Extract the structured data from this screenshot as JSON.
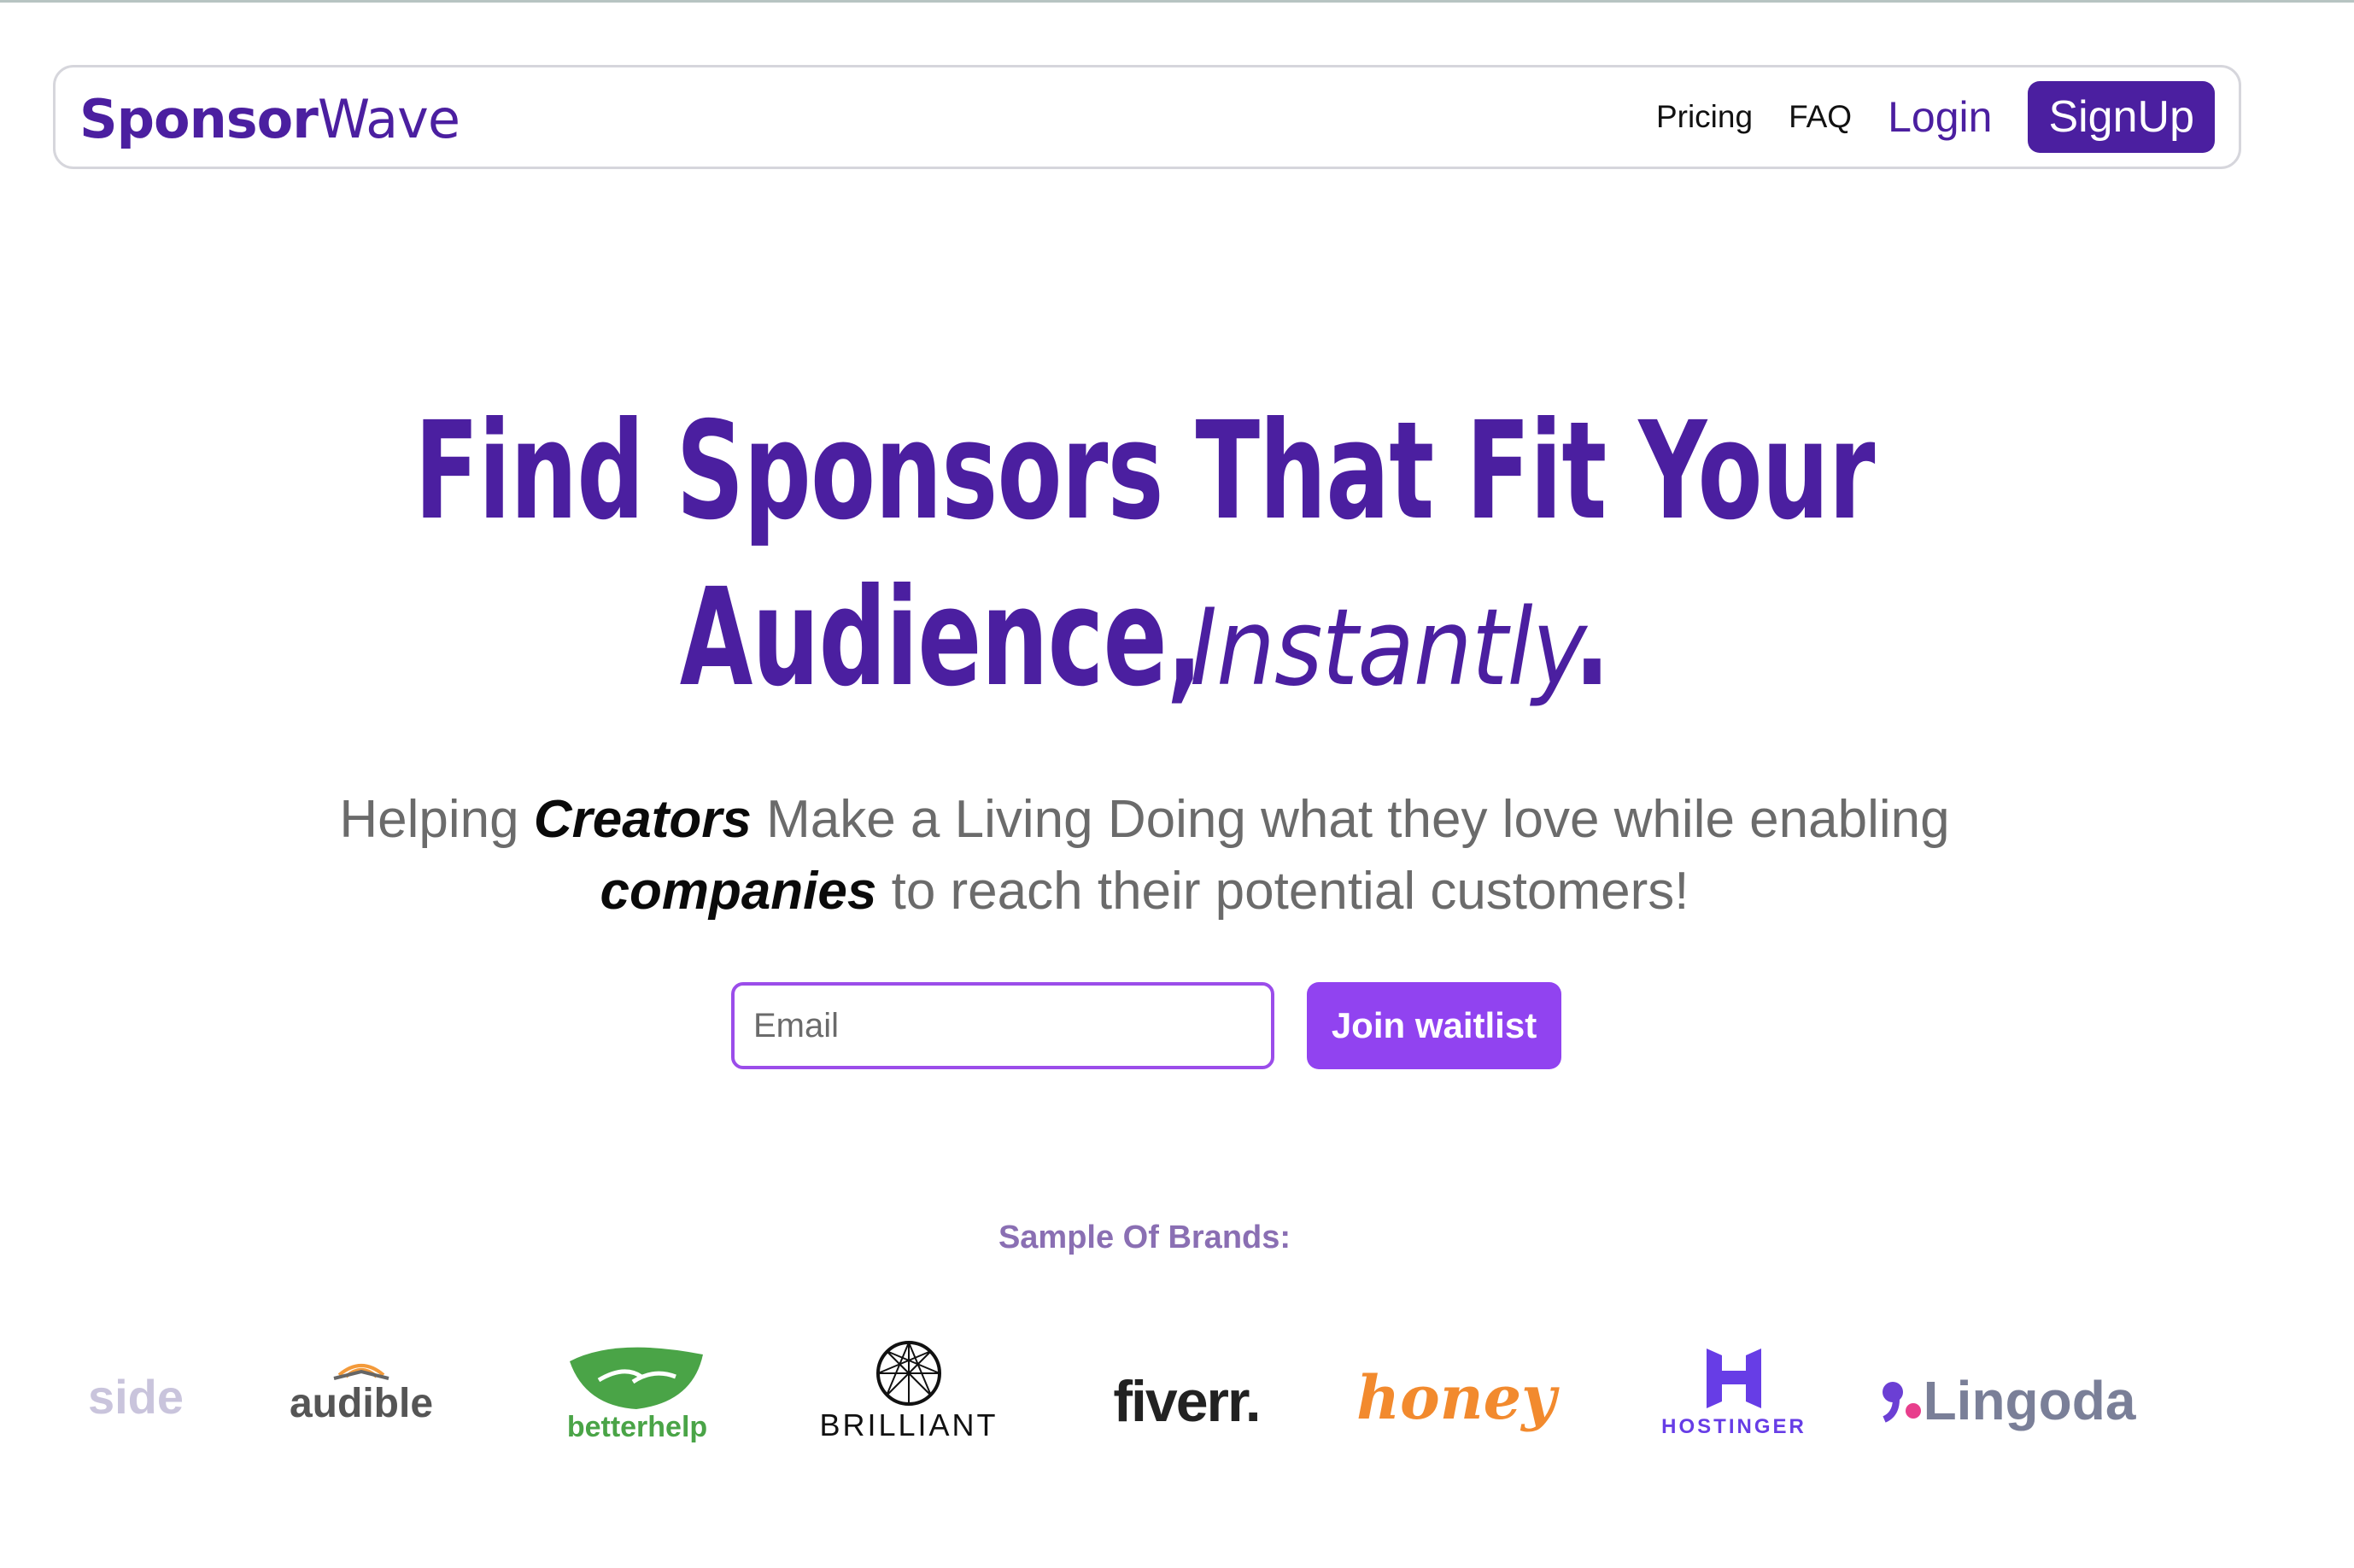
{
  "nav": {
    "logo_text_a": "Sponsor",
    "logo_text_b": "Wave",
    "links": [
      "Pricing",
      "FAQ"
    ],
    "login_label": "Login",
    "signup_label": "SignUp"
  },
  "hero": {
    "line1": "Find Sponsors That Fit Your",
    "line2_main": "Audience,",
    "line2_italic": "Instantly",
    "line2_end": "."
  },
  "subtitle": {
    "part1": "Helping ",
    "creators": "Creators",
    "part2": " Make a Living Doing what they love while enabling",
    "companies": "companies",
    "part3": " to reach their potential customers!"
  },
  "form": {
    "email_placeholder": "Email",
    "join_label": "Join waitlist"
  },
  "brands": {
    "label": "Sample Of Brands:",
    "items": [
      "side",
      "audible",
      "betterhelp",
      "BRILLIANT",
      "fiverr.",
      "honey",
      "HOSTINGER",
      "Lingoda"
    ]
  },
  "colors": {
    "brand_purple": "#4b1fa0",
    "accent_purple": "#9143f0",
    "text_gray": "#6b6b6b"
  }
}
